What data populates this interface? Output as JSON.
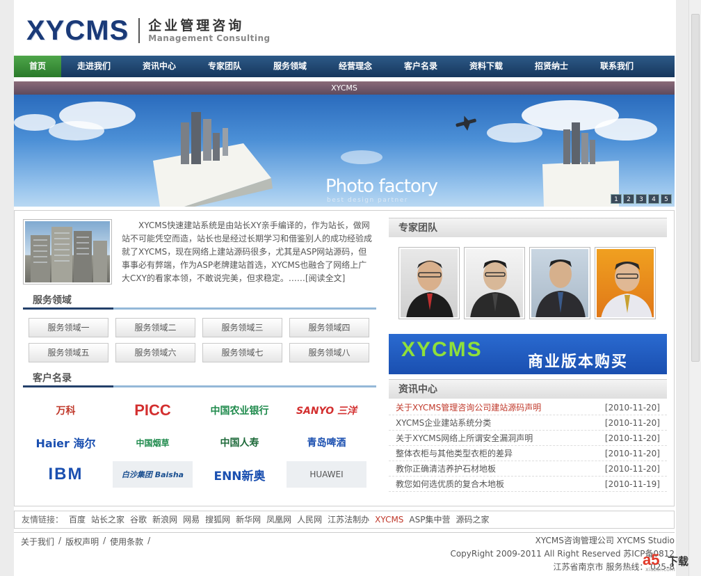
{
  "logo": {
    "main": "XYCMS",
    "cn": "企业管理咨询",
    "en": "Management Consulting"
  },
  "nav": [
    "首页",
    "走进我们",
    "资讯中心",
    "专家团队",
    "服务领域",
    "经营理念",
    "客户名录",
    "资料下载",
    "招贤纳士",
    "联系我们"
  ],
  "banner": {
    "caption": "XYCMS",
    "title": "Photo factory",
    "subtitle": "best design partner",
    "pages": [
      "1",
      "2",
      "3",
      "4",
      "5"
    ]
  },
  "intro": {
    "text": "XYCMS快速建站系统是由站长XY亲手编译的，作为站长，做网站不可能凭空而造，站长也是经过长期学习和借鉴别人的成功经验成就了XYCMS，现在网络上建站源码很多，尤其是ASP网站源码，但事事必有弊端，作为ASP老牌建站首选，XYCMS也融合了网络上广大CXY的看家本领，不敢说完美，但求稳定。……",
    "more": "[阅读全文]"
  },
  "services": {
    "title": "服务领域",
    "items": [
      "服务领域一",
      "服务领域二",
      "服务领域三",
      "服务领域四",
      "服务领域五",
      "服务领域六",
      "服务领域七",
      "服务领域八"
    ]
  },
  "clients": {
    "title": "客户名录",
    "items": [
      {
        "name": "万科",
        "color": "#c0392b"
      },
      {
        "name": "PICC",
        "color": "#d32f2f"
      },
      {
        "name": "中国农业银行",
        "color": "#1e8a4c"
      },
      {
        "name": "SANYO 三洋",
        "color": "#d32f2f"
      },
      {
        "name": "Haier 海尔",
        "color": "#1a4fb0"
      },
      {
        "name": "中国烟草",
        "color": "#1e8a4c"
      },
      {
        "name": "中国人寿",
        "color": "#1e6a3a"
      },
      {
        "name": "青岛啤酒",
        "color": "#1a4fb0"
      },
      {
        "name": "IBM",
        "color": "#1a4fb0"
      },
      {
        "name": "白沙集团 Baisha",
        "color": "#1a4f90"
      },
      {
        "name": "ENN新奥",
        "color": "#1a4fb0"
      },
      {
        "name": "HUAWEI",
        "color": "#555555"
      }
    ]
  },
  "experts": {
    "title": "专家团队"
  },
  "promo": {
    "en": "XYCMS",
    "cn": "商业版本购买"
  },
  "news": {
    "title": "资讯中心",
    "items": [
      {
        "title": "关于XYCMS管理咨询公司建站源码声明",
        "date": "[2010-11-20]"
      },
      {
        "title": "XYCMS企业建站系统分类",
        "date": "[2010-11-20]"
      },
      {
        "title": "关于XYCMS网络上所谓安全漏洞声明",
        "date": "[2010-11-20]"
      },
      {
        "title": "整体衣柜与其他类型衣柜的差异",
        "date": "[2010-11-20]"
      },
      {
        "title": "教你正确清洁养护石材地板",
        "date": "[2010-11-20]"
      },
      {
        "title": "教您如何选优质的复合木地板",
        "date": "[2010-11-19]"
      }
    ]
  },
  "links": {
    "label": "友情链接：",
    "items": [
      "百度",
      "站长之家",
      "谷歌",
      "新浪网",
      "网易",
      "搜狐网",
      "新华网",
      "凤凰网",
      "人民网",
      "江苏法制办",
      "XYCMS",
      "ASP集中营",
      "源码之家"
    ]
  },
  "footer": {
    "left": [
      "关于我们",
      "版权声明",
      "使用条款"
    ],
    "company": "XYCMS咨询管理公司  XYCMS Studio",
    "copyright": "CopyRight 2009-2011 All Right Reserved 苏ICP备0812",
    "address": "江苏省南京市  服务热线：  025-8"
  },
  "badge": {
    "a5": "a5",
    "text": "下载",
    "url": "xiazai.com"
  }
}
